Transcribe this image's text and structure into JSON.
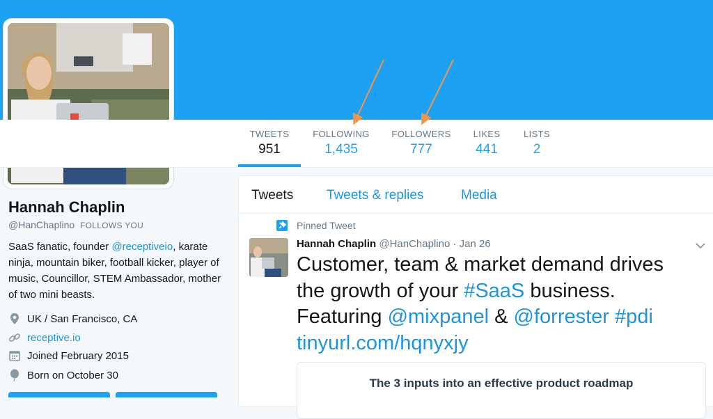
{
  "colors": {
    "brand": "#1da1f2",
    "link": "#1b95e0",
    "muted": "#657786",
    "annotation_arrow": "#f0964b"
  },
  "nav": [
    {
      "label": "TWEETS",
      "value": "951",
      "active": true
    },
    {
      "label": "FOLLOWING",
      "value": "1,435",
      "active": false
    },
    {
      "label": "FOLLOWERS",
      "value": "777",
      "active": false
    },
    {
      "label": "LIKES",
      "value": "441",
      "active": false
    },
    {
      "label": "LISTS",
      "value": "2",
      "active": false
    }
  ],
  "profile": {
    "name": "Hannah Chaplin",
    "handle": "@HanChaplino",
    "follows_you": "FOLLOWS YOU",
    "bio_1": "SaaS fanatic, founder ",
    "bio_link": "@receptiveio",
    "bio_2": ",",
    "bio_3": "karate ninja, mountain biker, football kicker, player of music, Councillor, STEM Ambassador, mother of two mini beasts.",
    "location": "UK / San Francisco, CA",
    "website": "receptive.io",
    "joined": "Joined February 2015",
    "born": "Born on October 30",
    "icons": {
      "location": "location-pin-icon",
      "website": "link-icon",
      "joined": "calendar-icon",
      "born": "balloon-icon"
    }
  },
  "tabs": [
    {
      "label": "Tweets",
      "active": true
    },
    {
      "label": "Tweets & replies",
      "active": false
    },
    {
      "label": "Media",
      "active": false
    }
  ],
  "tweet": {
    "pinned_label": "Pinned Tweet",
    "name": "Hannah Chaplin",
    "handle": "@HanChaplino",
    "separator": " · ",
    "time": "Jan 26",
    "line1": "Customer, team & market demand drives",
    "line2_a": "the growth of your ",
    "line2_hashtag": "#SaaS",
    "line2_b": " business.",
    "line3_a": "Featuring ",
    "line3_mention1": "@mixpanel",
    "line3_amp": " & ",
    "line3_mention2": "@forrester",
    "line3_space": " ",
    "line3_hashtag": "#pdi",
    "line4_link": "tinyurl.com/hqnyxjy",
    "card_title": "The 3 inputs into an effective product roadmap"
  }
}
